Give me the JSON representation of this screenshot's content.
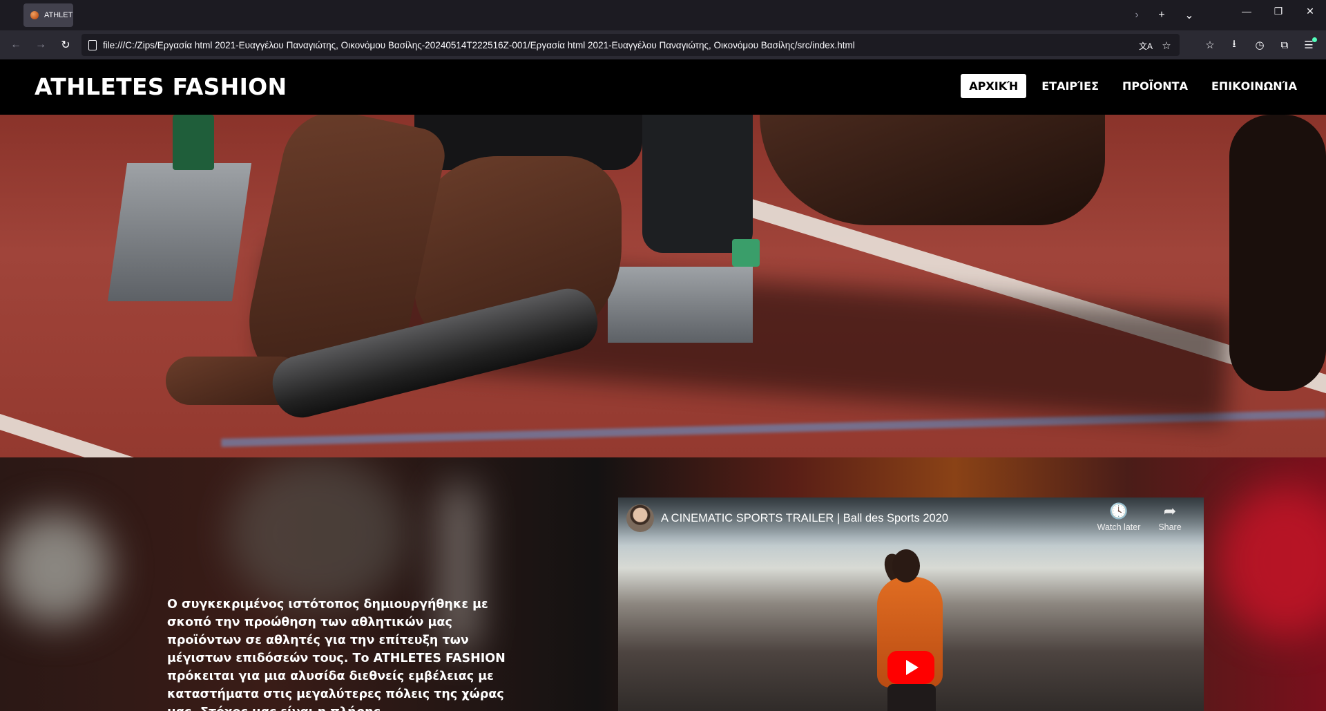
{
  "browser": {
    "tab": {
      "title": "ATHLETES FASHION"
    },
    "url": "file:///C:/Zips/Εργασία html 2021-Ευαγγέλου Παναγιώτης, Οικονόμου Βασίλης-20240514T222516Z-001/Εργασία html 2021-Ευαγγέλου Παναγιώτης, Οικονόμου Βασίλης/src/index.html",
    "icons": {
      "back": "←",
      "forward": "→",
      "reload": "↻",
      "translate": "文A",
      "star": "☆",
      "new_tab": "+",
      "list_tabs": "⌄",
      "scroll_tabs": "›",
      "minimize": "—",
      "restore": "❐",
      "close": "✕",
      "collections": "☆",
      "downloads": "⭳",
      "history": "◷",
      "extensions": "⧉",
      "sidebar": "☰"
    }
  },
  "site": {
    "logo": "ATHLETES FASHION",
    "menu": [
      {
        "label": "ΑΡΧΙΚΉ",
        "active": true
      },
      {
        "label": "ΕΤΑΙΡΊΕΣ",
        "active": false
      },
      {
        "label": "ΠΡΟΪΟΝΤΑ",
        "active": false
      },
      {
        "label": "ΕΠΙΚΟΙΝΩΝΊΑ",
        "active": false
      }
    ],
    "intro_text": "Ο συγκεκριμένος ιστότοπος δημιουργήθηκε με σκοπό την προώθηση των αθλητικών μας προϊόντων σε αθλητές για την επίτευξη των μέγιστων επιδόσεών τους. Το ATHLETES FASHION πρόκειται για μια αλυσίδα διεθνείς εμβέλειας με καταστήματα στις μεγαλύτερες πόλεις της χώρας μας. Στόχος μας είναι η πλήρης",
    "video": {
      "title": "A CINEMATIC SPORTS TRAILER | Ball des Sports 2020",
      "watch_later": "Watch later",
      "share": "Share",
      "icons": {
        "watch_later": "🕓",
        "share": "➦"
      }
    }
  }
}
